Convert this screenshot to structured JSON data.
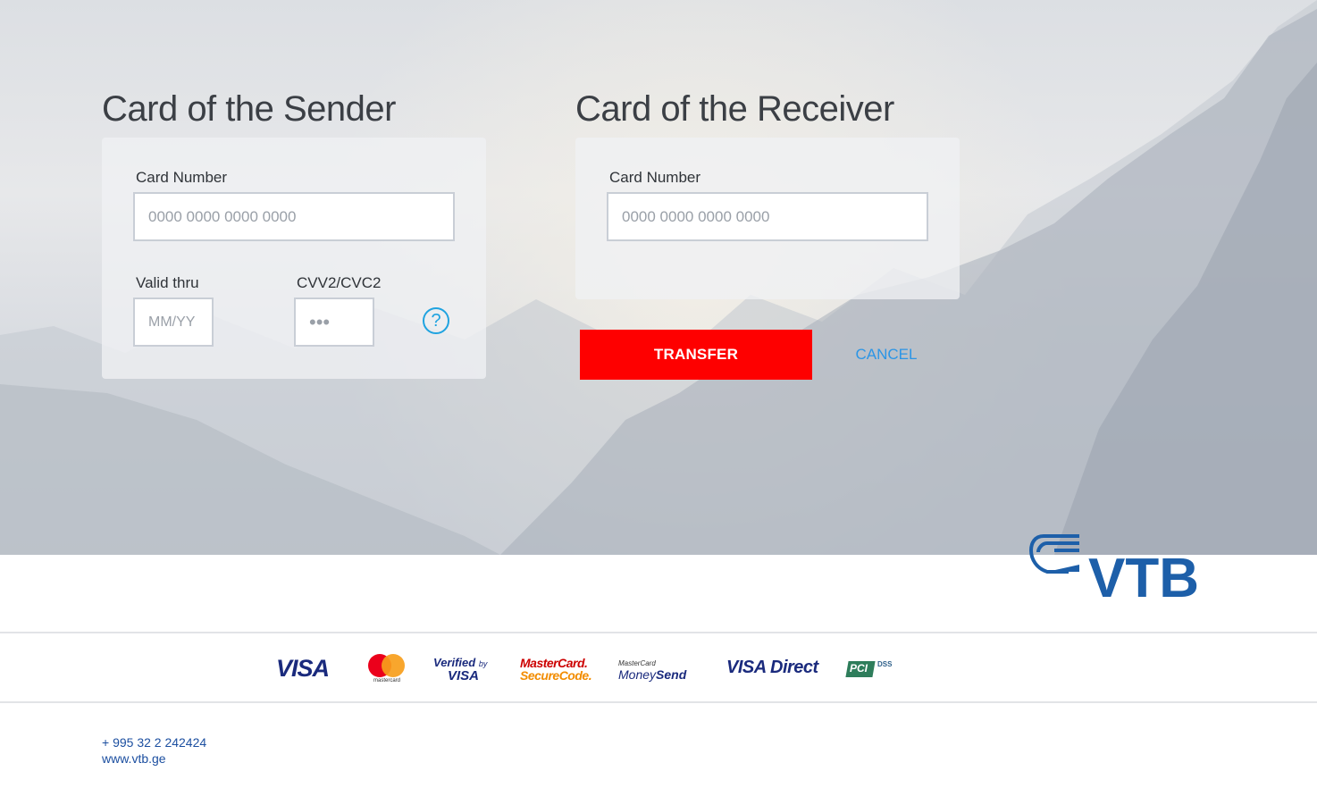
{
  "sender": {
    "title": "Card of the Sender",
    "card_number_label": "Card Number",
    "card_number_placeholder": "0000 0000 0000 0000",
    "valid_thru_label": "Valid thru",
    "valid_thru_placeholder": "MM/YY",
    "cvv_label": "CVV2/CVC2",
    "cvv_placeholder": "•••",
    "help_icon": "question-circle-icon",
    "help_glyph": "?"
  },
  "receiver": {
    "title": "Card of the Receiver",
    "card_number_label": "Card Number",
    "card_number_placeholder": "0000 0000 0000 0000"
  },
  "actions": {
    "transfer_label": "TRANSFER",
    "cancel_label": "CANCEL"
  },
  "brand": {
    "name": "VTB",
    "color": "#1d5fa9"
  },
  "payment_logos": {
    "visa": "VISA",
    "mastercard": "mastercard",
    "verified_top": "Verified",
    "verified_by": "by",
    "verified_visa": "VISA",
    "securecode_top": "MasterCard.",
    "securecode_bottom": "SecureCode.",
    "moneysend_top": "MasterCard",
    "moneysend_money": "Money",
    "moneysend_send": "Send",
    "visa_direct": "VISA Direct",
    "pci": "PCI",
    "dss": "DSS"
  },
  "footer": {
    "phone": "+ 995 32 2 242424",
    "website": "www.vtb.ge"
  },
  "colors": {
    "accent_red": "#fe0000",
    "link_blue": "#2b95e6",
    "footer_blue": "#1c4fa0"
  }
}
